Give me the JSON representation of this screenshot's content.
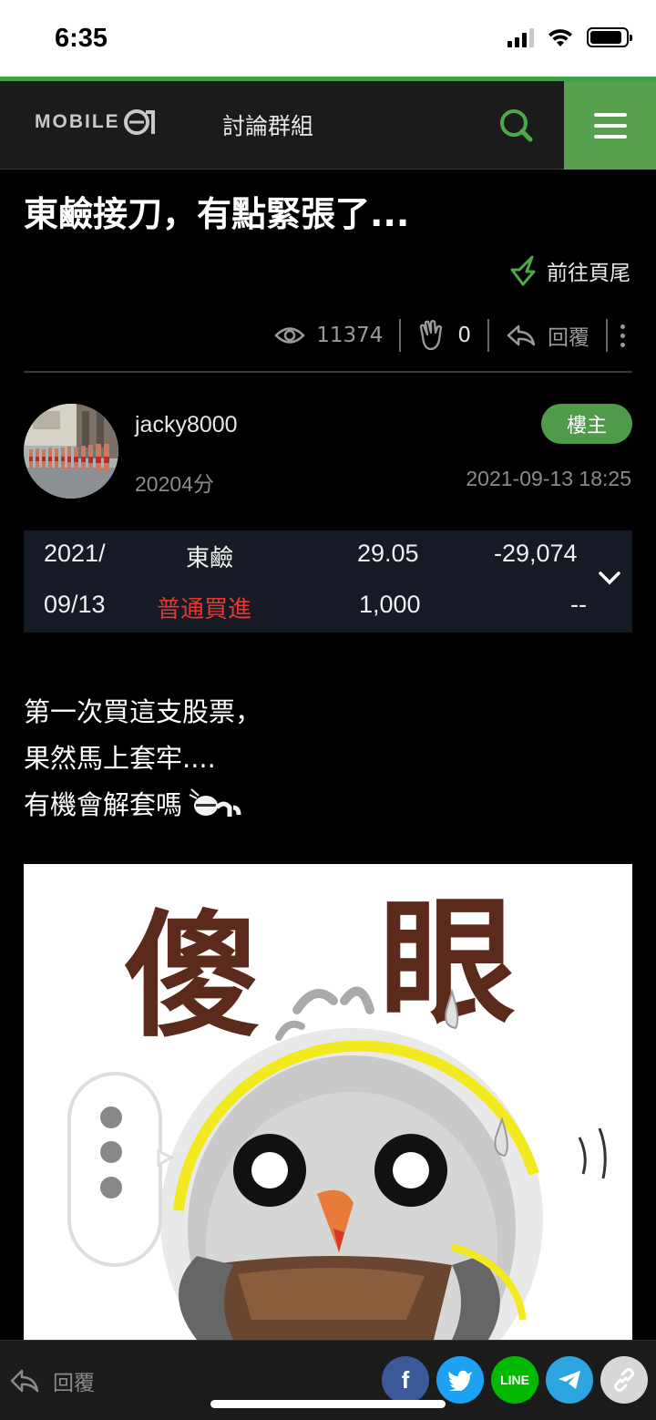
{
  "status_bar": {
    "time": "6:35",
    "battery_level": 0.9
  },
  "nav": {
    "logo_text": "MOBILE",
    "title": "討論群組",
    "accent_color": "#56a04e"
  },
  "post": {
    "title": "東鹼接刀，有點緊張了...",
    "goto_end_label": "前往頁尾",
    "stats": {
      "views": "11374",
      "likes": "0",
      "reply_label": "回覆"
    },
    "author": {
      "username": "jacky8000",
      "score": "20204分",
      "badge": "樓主",
      "date": "2021-09-13 18:25"
    },
    "trade": {
      "date_line1": "2021/",
      "date_line2": "09/13",
      "stock": "東鹼",
      "action": "普通買進",
      "price": "29.05",
      "shares": "1,000",
      "amount": "-29,074",
      "extra": "--"
    },
    "body_lines": [
      "第一次買這支股票，",
      "果然馬上套牢....",
      "有機會解套嗎"
    ],
    "sticker_text": [
      "傻",
      "眼"
    ]
  },
  "bottom_bar": {
    "reply_label": "回覆",
    "share": {
      "facebook": "f",
      "line": "LINE"
    }
  },
  "icons": [
    "search-icon",
    "menu-icon",
    "goto-end-icon",
    "eye-icon",
    "clap-icon",
    "reply-icon",
    "more-icon",
    "chevron-down-icon",
    "facebook-icon",
    "twitter-icon",
    "line-icon",
    "telegram-icon",
    "link-icon"
  ]
}
